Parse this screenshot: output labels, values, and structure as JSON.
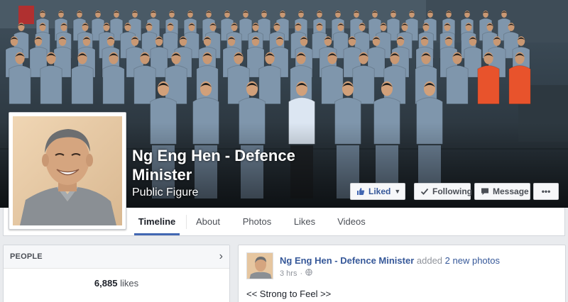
{
  "page": {
    "name": "Ng Eng Hen - Defence Minister",
    "category": "Public Figure"
  },
  "actions": {
    "liked_label": "Liked",
    "following_label": "Following",
    "message_label": "Message",
    "more_label": "•••"
  },
  "tabs": [
    {
      "label": "Timeline",
      "active": true
    },
    {
      "label": "About",
      "active": false
    },
    {
      "label": "Photos",
      "active": false
    },
    {
      "label": "Likes",
      "active": false
    },
    {
      "label": "Videos",
      "active": false
    }
  ],
  "people": {
    "title": "PEOPLE",
    "likes_count": "6,885",
    "likes_label": "likes"
  },
  "post": {
    "author": "Ng Eng Hen - Defence Minister",
    "action_text": "added",
    "link_text": "2 new photos",
    "time": "3 hrs",
    "text": "<< Strong to Feel >>"
  },
  "colors": {
    "fb_blue": "#4267b2",
    "link": "#365899",
    "uniform": "#7f96ac",
    "cover_bg": "#35434e"
  },
  "icons": {
    "liked": "thumbs-up-icon",
    "following": "check-icon",
    "message": "speech-bubble-icon",
    "more": "more-dots-icon",
    "people_arrow": "chevron-right-icon",
    "privacy": "globe-icon"
  }
}
